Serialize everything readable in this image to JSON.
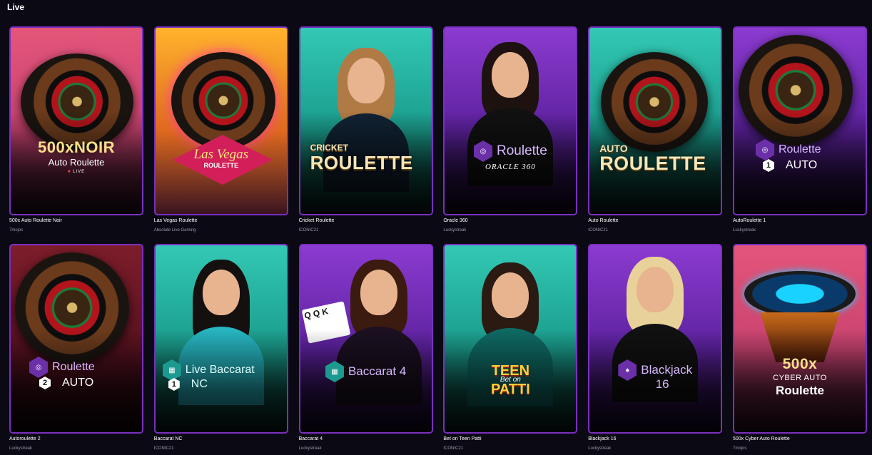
{
  "section": {
    "title": "Live"
  },
  "colors": {
    "card_border": "#7a2fc0",
    "background": "#0b0a14",
    "provider_text": "#9a98a8"
  },
  "games": [
    {
      "title": "500x Auto Roulette Noir",
      "provider": "7mojos",
      "art": {
        "line1": "500xNOIR",
        "line2": "Auto Roulette",
        "line3": "LIVE",
        "flag_icon": "uk-flag-icon"
      }
    },
    {
      "title": "Las Vegas Roulette",
      "provider": "Absolute Live Gaming",
      "art": {
        "line1": "Las Vegas",
        "line2": "ROULETTE"
      }
    },
    {
      "title": "Cricket Roulette",
      "provider": "ICONIC21",
      "art": {
        "line1": "CRICKET",
        "line2": "ROULETTE"
      }
    },
    {
      "title": "Oracle 360",
      "provider": "Luckystreak",
      "art": {
        "line1": "Roulette",
        "line2": "ORACLE 360",
        "badge_icon": "roulette-hex-icon"
      }
    },
    {
      "title": "Auto Roulette",
      "provider": "ICONIC21",
      "art": {
        "line1": "AUTO",
        "line2": "ROULETTE"
      }
    },
    {
      "title": "AutoRoulette 1",
      "provider": "Luckystreak",
      "art": {
        "line1": "Roulette",
        "line2": "AUTO",
        "number": "1",
        "badge_icon": "roulette-hex-icon"
      }
    },
    {
      "title": "Autoroulette 2",
      "provider": "Luckystreak",
      "art": {
        "line1": "Roulette",
        "line2": "AUTO",
        "number": "2",
        "badge_icon": "roulette-hex-icon"
      }
    },
    {
      "title": "Baccarat NC",
      "provider": "ICONIC21",
      "art": {
        "line1": "Live Baccarat",
        "line2": "NC",
        "number": "1",
        "badge_icon": "baccarat-hex-icon"
      }
    },
    {
      "title": "Baccarat 4",
      "provider": "Luckystreak",
      "art": {
        "line1": "Baccarat 4",
        "badge_icon": "baccarat-hex-icon"
      }
    },
    {
      "title": "Bet on Teen Patti",
      "provider": "ICONIC21",
      "art": {
        "line1": "TEEN",
        "line2": "Bet on",
        "line3": "PATTI"
      }
    },
    {
      "title": "Blackjack 16",
      "provider": "Luckystreak",
      "art": {
        "line1": "Blackjack",
        "line2": "16",
        "badge_icon": "blackjack-hex-icon"
      }
    },
    {
      "title": "500x Cyber Auto Roulette",
      "provider": "7mojos",
      "art": {
        "line1": "500x",
        "line2": "CYBER AUTO",
        "line3": "Roulette"
      }
    }
  ]
}
